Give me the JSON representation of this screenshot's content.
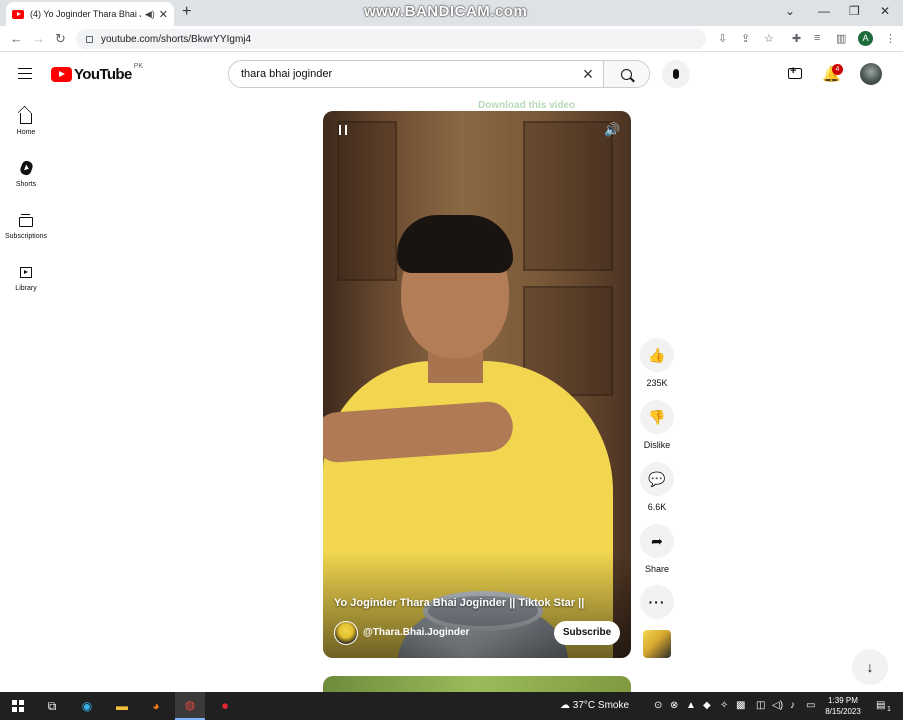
{
  "browser": {
    "tab_title": "(4) Yo Joginder Thara Bhai Jo",
    "url": "youtube.com/shorts/BkwrYYIgmj4",
    "watermark": "www.BANDICAM.com",
    "profile_initial": "A"
  },
  "masthead": {
    "logo_text": "YouTube",
    "region": "PK",
    "search_value": "thara bhai joginder",
    "notifications_count": "4"
  },
  "sidebar": {
    "items": [
      {
        "label": "Home"
      },
      {
        "label": "Shorts"
      },
      {
        "label": "Subscriptions"
      },
      {
        "label": "Library"
      }
    ]
  },
  "short": {
    "download_banner": "Download this video",
    "title": "Yo Joginder Thara Bhai Joginder || Tiktok Star ||",
    "channel_handle": "@Thara.Bhai.Joginder",
    "subscribe_label": "Subscribe"
  },
  "actions": {
    "likes": "235K",
    "dislike_label": "Dislike",
    "comments": "6.6K",
    "share_label": "Share"
  },
  "taskbar": {
    "weather": "37°C  Smoke",
    "time": "1:39 PM",
    "date": "8/15/2023",
    "notif_count": "1"
  }
}
